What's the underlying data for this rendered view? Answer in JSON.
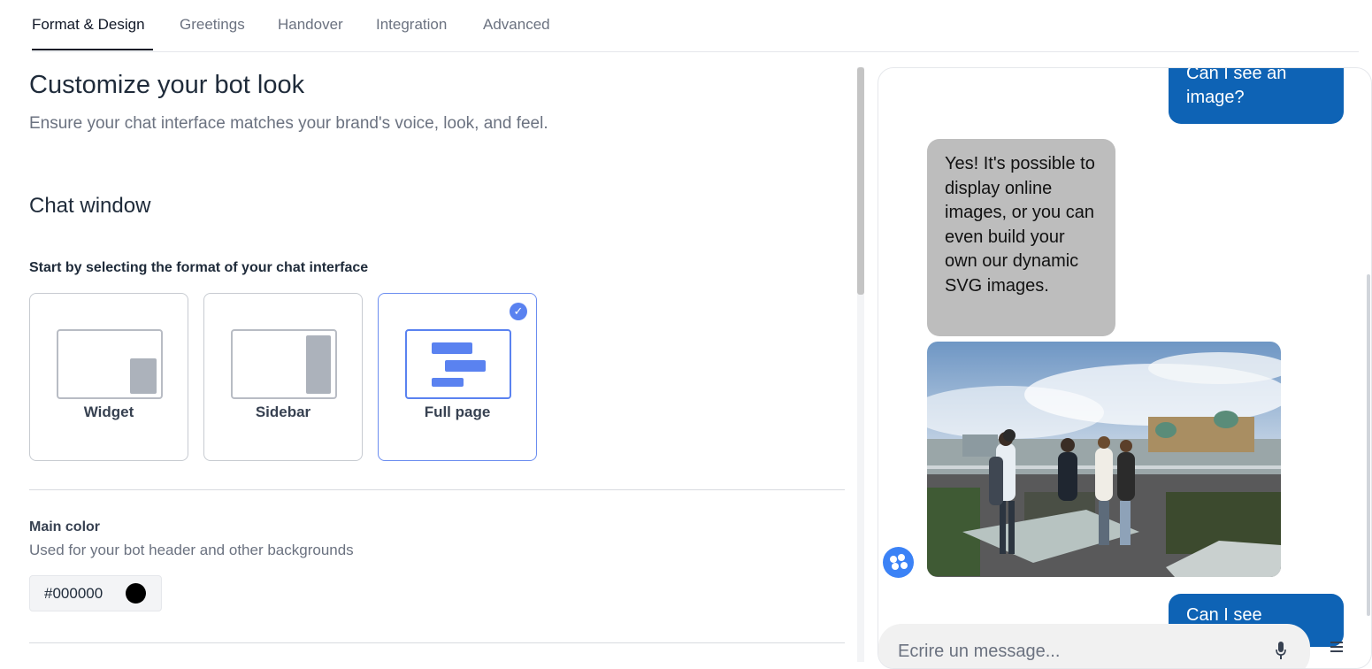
{
  "tabs": [
    {
      "label": "Format & Design"
    },
    {
      "label": "Greetings"
    },
    {
      "label": "Handover"
    },
    {
      "label": "Integration"
    },
    {
      "label": "Advanced"
    }
  ],
  "active_tab": "Format & Design",
  "page": {
    "title": "Customize your bot look",
    "subtitle": "Ensure your chat interface matches your brand's voice, look, and feel."
  },
  "chat_window": {
    "heading": "Chat window",
    "prompt": "Start by selecting the format of your chat interface",
    "formats": [
      {
        "label": "Widget",
        "selected": false
      },
      {
        "label": "Sidebar",
        "selected": false
      },
      {
        "label": "Full page",
        "selected": true
      }
    ]
  },
  "main_color": {
    "title": "Main color",
    "description": "Used for your bot header and other backgrounds",
    "value": "#000000",
    "swatch": "#000000"
  },
  "colors": {
    "accent": "#5a82f0",
    "user_bubble": "#0e63b5",
    "bot_bubble": "#bdbdbd",
    "avatar": "#3b82f6"
  },
  "preview": {
    "messages": [
      {
        "from": "user",
        "text": "Can I see an image?"
      },
      {
        "from": "bot",
        "text": "Yes! It's possible to display online images, or you can even build your own our dynamic SVG images."
      },
      {
        "from": "bot",
        "type": "image"
      },
      {
        "from": "user",
        "text": "Can I see"
      }
    ],
    "input_placeholder": "Ecrire un message...",
    "icons": {
      "mic": "microphone-icon",
      "menu": "menu-icon",
      "avatar": "bot-avatar-icon"
    }
  }
}
